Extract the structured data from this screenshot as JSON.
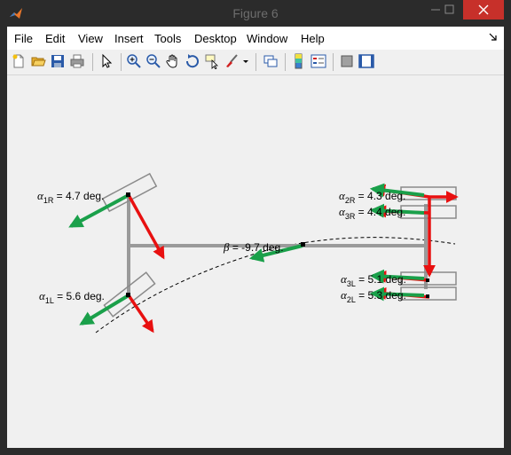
{
  "window": {
    "title": "Figure 6",
    "icon": "matlab-logo-icon",
    "close_color": "#c7302a"
  },
  "menu": {
    "items": [
      "File",
      "Edit",
      "View",
      "Insert",
      "Tools",
      "Desktop",
      "Window",
      "Help"
    ]
  },
  "toolbar": {
    "icons": [
      "new-figure-icon",
      "open-file-icon",
      "save-icon",
      "print-icon",
      "edit-plot-arrow-icon",
      "zoom-in-icon",
      "zoom-out-icon",
      "pan-hand-icon",
      "rotate-3d-icon",
      "data-cursor-icon",
      "brush-icon",
      "brush-dropdown-icon",
      "link-plot-icon",
      "colorbar-icon",
      "legend-icon",
      "hide-plot-tools-icon",
      "show-plot-tools-icon"
    ]
  },
  "plot": {
    "colors": {
      "force": "#e81010",
      "slip": "#1aa04a",
      "frame": "#9a9a9a",
      "wheel": "#8a8a8a"
    },
    "labels": {
      "a1R": {
        "sym": "α",
        "sub": "1R",
        "text": " = 4.7 deg."
      },
      "a1L": {
        "sym": "α",
        "sub": "1L",
        "text": " = 5.6 deg."
      },
      "beta": {
        "sym": "β",
        "text": " = -9.7 deg."
      },
      "a2R": {
        "sym": "α",
        "sub": "2R",
        "text": " = 4.3 deg."
      },
      "a3R": {
        "sym": "α",
        "sub": "3R",
        "text": " = 4.4 deg."
      },
      "a3L": {
        "sym": "α",
        "sub": "3L",
        "text": " = 5.1 deg."
      },
      "a2L": {
        "sym": "α",
        "sub": "2L",
        "text": " = 5.3 deg."
      }
    }
  }
}
